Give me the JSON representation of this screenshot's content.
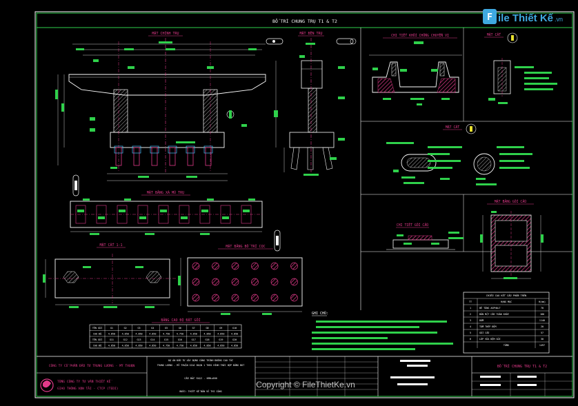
{
  "sheet": {
    "title": "BỐ TRÍ CHUNG TRỤ T1 & T2",
    "watermark_brand": "File Thiết Kế.vn",
    "copyright": "Copyright © FileThietKe.vn"
  },
  "views": {
    "mat_chinh": "MẶT CHÍNH TRỤ",
    "mat_ben": "MẶT BÊN TRỤ",
    "chi_tiet_khoi": "CHI TIẾT KHỐI CHỐNG CHUYỂN VỊ",
    "mat_cat_a": "MẶT CẮT",
    "mat_cat_b": "MẶT CẮT",
    "mat_bang_xa_mu": "MẶT BẰNG XÀ MŨ TRỤ",
    "mat_cat_11": "MẶT CẮT 1-1",
    "mat_bang_coc": "MẶT BẰNG BỐ TRÍ CỌC",
    "chi_tiet_goi": "CHI TIẾT GỐI CẦU",
    "mat_bang_goi": "MẶT BẰNG GỐI CẦU",
    "bang_cao_do": "BẢNG CAO ĐỘ ĐẶT GỐI",
    "ghi_chu": "GHI CHÚ:"
  },
  "elevation_table": {
    "header": [
      "TÊN GỐI",
      "G1",
      "G2",
      "G3",
      "G4",
      "G5",
      "G6",
      "G7",
      "G8",
      "G9",
      "G10"
    ],
    "rows": [
      [
        "CAO ĐỘ",
        "4.850",
        "4.850",
        "4.850",
        "4.850",
        "4.750",
        "4.750",
        "4.850",
        "4.850",
        "4.850",
        "4.850"
      ],
      [
        "TÊN GỐI",
        "G11",
        "G12",
        "G13",
        "G14",
        "G15",
        "G16",
        "G17",
        "G18",
        "G19",
        "G20"
      ],
      [
        "CAO ĐỘ",
        "4.850",
        "4.850",
        "4.850",
        "4.850",
        "4.750",
        "4.750",
        "4.850",
        "4.850",
        "4.850",
        "4.850"
      ]
    ]
  },
  "quantity_table": {
    "title": "CHIỀU CAO KẾT CẤU PHẦN TRÊN",
    "header": [
      "TT",
      "HẠNG MỤC",
      "H(mm)"
    ],
    "rows": [
      [
        "1",
        "BÊ TÔNG ASPHALT",
        "70"
      ],
      [
        "2",
        "BẢN MẶT CẦU TOÀN KHỐI",
        "180"
      ],
      [
        "3",
        "DẦM",
        "1140"
      ],
      [
        "4",
        "TẤM THÉP ĐỆM",
        "20"
      ],
      [
        "5",
        "GỐI CẦU",
        "57"
      ],
      [
        "6",
        "LỚP VỮA ĐỆM GỐI",
        "30"
      ]
    ],
    "total_label": "TỔNG",
    "total_value": "1497"
  },
  "title_block": {
    "company": "CÔNG TY CỔ PHẦN ĐẦU TƯ TRUNG LƯƠNG - MỸ THUẬN",
    "designer_1": "TỔNG CÔNG TY TƯ VẤN THIẾT KẾ",
    "designer_2": "GIAO THÔNG VẬN TẢI - CTCP (TEDI)",
    "project": "DỰ ÁN ĐẦU TƯ XÂY DỰNG CÔNG TRÌNH ĐƯỜNG CAO TỐC",
    "project_2": "TRUNG LƯƠNG - MỸ THUẬN GIAI ĐOẠN 1 THEO HÌNH THỨC HỢP ĐỒNG BOT",
    "item": "CẦU BẮC SUẠI - KM0+000",
    "phase": "BƯỚC: THIẾT KẾ BẢN VẼ THI CÔNG",
    "drawing_title": "BỐ TRÍ CHUNG TRỤ T1 & T2"
  }
}
